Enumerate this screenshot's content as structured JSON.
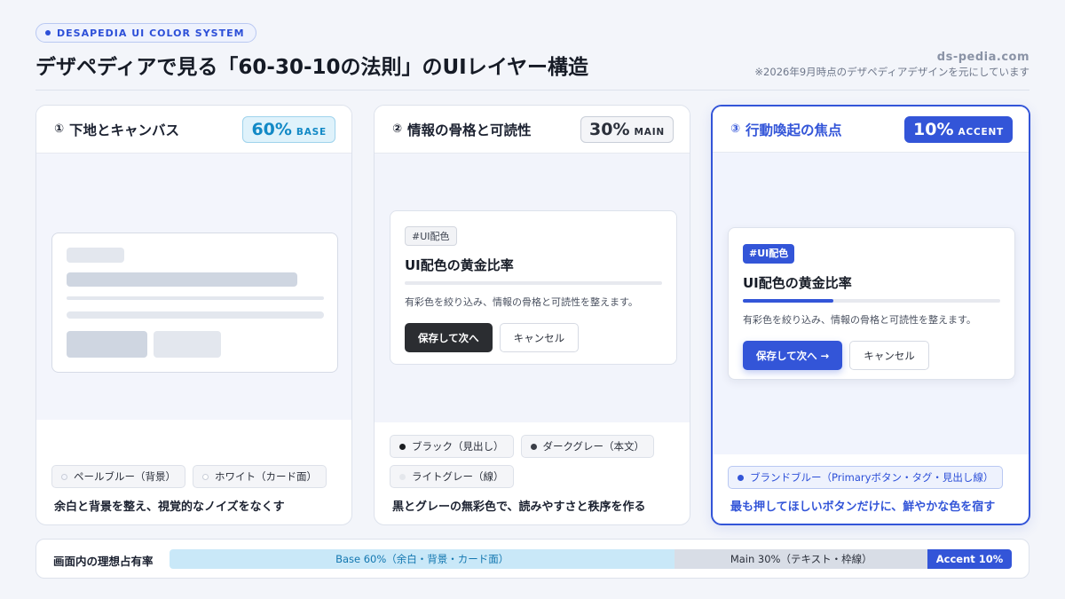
{
  "header": {
    "badge": "DESAPEDIA UI COLOR SYSTEM",
    "title": "デザペディアで見る「60-30-10の法則」のUIレイヤー構造",
    "site": "ds-pedia.com",
    "note": "※2026年9月時点のデザペディアデザインを元にしています"
  },
  "cards": [
    {
      "num": "①",
      "title": "下地とキャンバス",
      "pct_value": "60%",
      "pct_label": "BASE",
      "chips": [
        {
          "label": "ペールブルー（背景）",
          "color": "#f3f5fc"
        },
        {
          "label": "ホワイト（カード面）",
          "color": "#ffffff"
        }
      ],
      "desc": "余白と背景を整え、視覚的なノイズをなくす"
    },
    {
      "num": "②",
      "title": "情報の骨格と可読性",
      "pct_value": "30%",
      "pct_label": "MAIN",
      "mock": {
        "tag": "#UI配色",
        "title": "UI配色の黄金比率",
        "text": "有彩色を絞り込み、情報の骨格と可読性を整えます。",
        "primary": "保存して次へ",
        "secondary": "キャンセル"
      },
      "chips": [
        {
          "label": "ブラック（見出し）",
          "color": "#1b1d22"
        },
        {
          "label": "ダークグレー（本文）",
          "color": "#3a3e47"
        },
        {
          "label": "ライトグレー（線）",
          "color": "#e4e7ec"
        }
      ],
      "desc": "黒とグレーの無彩色で、読みやすさと秩序を作る"
    },
    {
      "num": "③",
      "title": "行動喚起の焦点",
      "pct_value": "10%",
      "pct_label": "ACCENT",
      "mock": {
        "tag": "#UI配色",
        "title": "UI配色の黄金比率",
        "text": "有彩色を絞り込み、情報の骨格と可読性を整えます。",
        "primary": "保存して次へ →",
        "secondary": "キャンセル"
      },
      "chips": [
        {
          "label": "ブランドブルー（Primaryボタン・タグ・見出し線）",
          "color": "#3355d8"
        }
      ],
      "desc": "最も押してほしいボタンだけに、鮮やかな色を宿す"
    }
  ],
  "ratio": {
    "label": "画面内の理想占有率",
    "segments": [
      {
        "label": "Base 60%（余白・背景・カード面）",
        "share": 60
      },
      {
        "label": "Main 30%（テキスト・枠線）",
        "share": 30
      },
      {
        "label": "Accent 10%",
        "share": 10
      }
    ]
  },
  "colors": {
    "accent": "#3355d8",
    "base": "#c9e8f8",
    "main": "#d8dde6"
  }
}
